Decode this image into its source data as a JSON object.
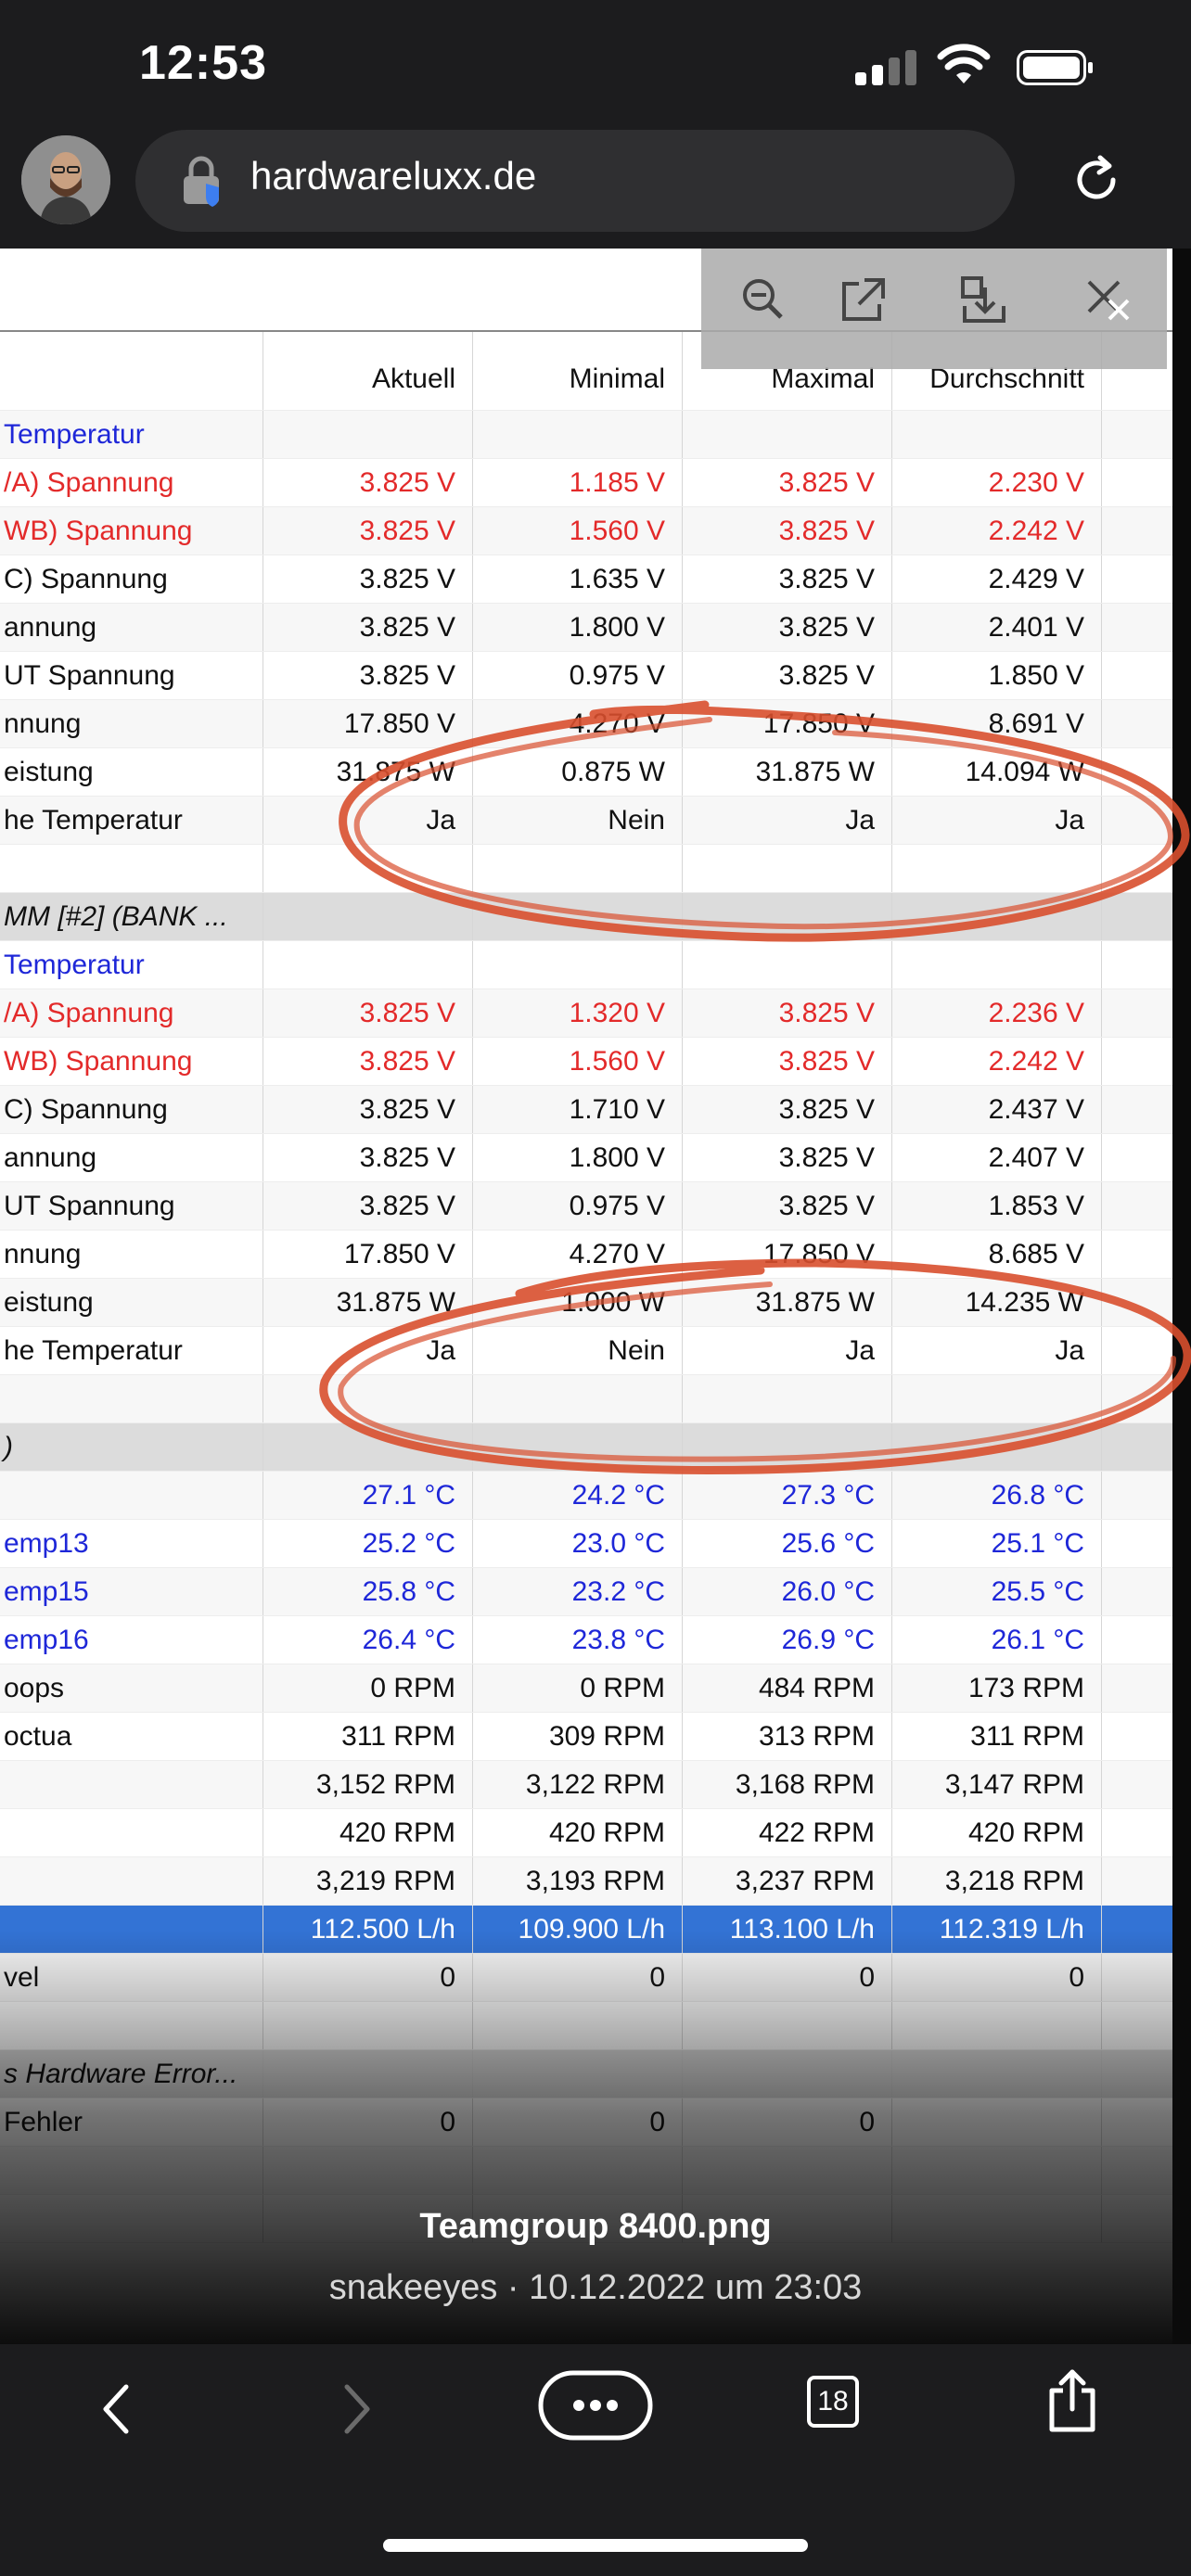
{
  "status_bar": {
    "time": "12:53"
  },
  "browser": {
    "url": "hardwareluxx.de"
  },
  "table": {
    "columns": [
      "",
      "Aktuell",
      "Minimal",
      "Maximal",
      "Durchschnitt"
    ],
    "rows": [
      {
        "style": "blue",
        "cells": [
          "Temperatur",
          "",
          "",
          "",
          ""
        ]
      },
      {
        "style": "red",
        "cells": [
          "/A) Spannung",
          "3.825 V",
          "1.185 V",
          "3.825 V",
          "2.230 V"
        ]
      },
      {
        "style": "red",
        "cells": [
          "WB) Spannung",
          "3.825 V",
          "1.560 V",
          "3.825 V",
          "2.242 V"
        ]
      },
      {
        "style": "black",
        "cells": [
          "C) Spannung",
          "3.825 V",
          "1.635 V",
          "3.825 V",
          "2.429 V"
        ]
      },
      {
        "style": "black",
        "cells": [
          "annung",
          "3.825 V",
          "1.800 V",
          "3.825 V",
          "2.401 V"
        ]
      },
      {
        "style": "black",
        "cells": [
          "UT Spannung",
          "3.825 V",
          "0.975 V",
          "3.825 V",
          "1.850 V"
        ]
      },
      {
        "style": "black",
        "cells": [
          "nnung",
          "17.850 V",
          "4.270 V",
          "17.850 V",
          "8.691 V"
        ]
      },
      {
        "style": "black",
        "cells": [
          "eistung",
          "31.875 W",
          "0.875 W",
          "31.875 W",
          "14.094 W"
        ]
      },
      {
        "style": "black",
        "cells": [
          "he Temperatur",
          "Ja",
          "Nein",
          "Ja",
          "Ja"
        ]
      },
      {
        "style": "blank",
        "cells": [
          "",
          "",
          "",
          "",
          ""
        ]
      },
      {
        "style": "group",
        "cells": [
          "MM [#2] (BANK ...",
          "",
          "",
          "",
          ""
        ]
      },
      {
        "style": "blue",
        "cells": [
          "Temperatur",
          "",
          "",
          "",
          ""
        ]
      },
      {
        "style": "red",
        "cells": [
          "/A) Spannung",
          "3.825 V",
          "1.320 V",
          "3.825 V",
          "2.236 V"
        ]
      },
      {
        "style": "red",
        "cells": [
          "WB) Spannung",
          "3.825 V",
          "1.560 V",
          "3.825 V",
          "2.242 V"
        ]
      },
      {
        "style": "black",
        "cells": [
          "C) Spannung",
          "3.825 V",
          "1.710 V",
          "3.825 V",
          "2.437 V"
        ]
      },
      {
        "style": "black",
        "cells": [
          "annung",
          "3.825 V",
          "1.800 V",
          "3.825 V",
          "2.407 V"
        ]
      },
      {
        "style": "black",
        "cells": [
          "UT Spannung",
          "3.825 V",
          "0.975 V",
          "3.825 V",
          "1.853 V"
        ]
      },
      {
        "style": "black",
        "cells": [
          "nnung",
          "17.850 V",
          "4.270 V",
          "17.850 V",
          "8.685 V"
        ]
      },
      {
        "style": "black",
        "cells": [
          "eistung",
          "31.875 W",
          "1.000 W",
          "31.875 W",
          "14.235 W"
        ]
      },
      {
        "style": "black",
        "cells": [
          "he Temperatur",
          "Ja",
          "Nein",
          "Ja",
          "Ja"
        ]
      },
      {
        "style": "blank",
        "cells": [
          "",
          "",
          "",
          "",
          ""
        ]
      },
      {
        "style": "group",
        "cells": [
          ")",
          "",
          "",
          "",
          ""
        ]
      },
      {
        "style": "blue",
        "cells": [
          "",
          "27.1 °C",
          "24.2 °C",
          "27.3 °C",
          "26.8 °C"
        ]
      },
      {
        "style": "blue",
        "cells": [
          "emp13",
          "25.2 °C",
          "23.0 °C",
          "25.6 °C",
          "25.1 °C"
        ]
      },
      {
        "style": "blue",
        "cells": [
          "emp15",
          "25.8 °C",
          "23.2 °C",
          "26.0 °C",
          "25.5 °C"
        ]
      },
      {
        "style": "blue",
        "cells": [
          "emp16",
          "26.4 °C",
          "23.8 °C",
          "26.9 °C",
          "26.1 °C"
        ]
      },
      {
        "style": "black",
        "cells": [
          "oops",
          "0 RPM",
          "0 RPM",
          "484 RPM",
          "173 RPM"
        ]
      },
      {
        "style": "black",
        "cells": [
          "octua",
          "311 RPM",
          "309 RPM",
          "313 RPM",
          "311 RPM"
        ]
      },
      {
        "style": "black",
        "cells": [
          "",
          "3,152 RPM",
          "3,122 RPM",
          "3,168 RPM",
          "3,147 RPM"
        ]
      },
      {
        "style": "black",
        "cells": [
          "",
          "420 RPM",
          "420 RPM",
          "422 RPM",
          "420 RPM"
        ]
      },
      {
        "style": "black",
        "cells": [
          "",
          "3,219 RPM",
          "3,193 RPM",
          "3,237 RPM",
          "3,218 RPM"
        ]
      },
      {
        "style": "sel",
        "cells": [
          "",
          "112.500 L/h",
          "109.900 L/h",
          "113.100 L/h",
          "112.319 L/h"
        ]
      },
      {
        "style": "black",
        "cells": [
          "vel",
          "0",
          "0",
          "0",
          "0"
        ]
      },
      {
        "style": "blank",
        "cells": [
          "",
          "",
          "",
          "",
          ""
        ]
      },
      {
        "style": "group",
        "cells": [
          "s Hardware Error...",
          "",
          "",
          "",
          ""
        ]
      },
      {
        "style": "black",
        "cells": [
          "Fehler",
          "0",
          "0",
          "0",
          ""
        ]
      },
      {
        "style": "blank",
        "cells": [
          "",
          "",
          "",
          "",
          ""
        ]
      },
      {
        "style": "blank",
        "cells": [
          "",
          "",
          "",
          "",
          ""
        ]
      }
    ]
  },
  "caption": {
    "title": "Teamgroup 8400.png",
    "subtitle": "snakeeyes · 10.12.2022 um 23:03"
  },
  "tabs_count": "18",
  "icons": [
    "zoom-out-icon",
    "open-external-icon",
    "download-icon",
    "close-icon",
    "back-icon",
    "forward-icon",
    "more-icon",
    "tabs-icon",
    "share-icon",
    "reload-icon",
    "lock-icon",
    "wifi-icon",
    "battery-icon",
    "signal-icon"
  ],
  "colors": {
    "accent_red": "#e32a2a",
    "accent_blue": "#1e27d8",
    "selection": "#3373d5",
    "scribble": "#d84f2e"
  }
}
